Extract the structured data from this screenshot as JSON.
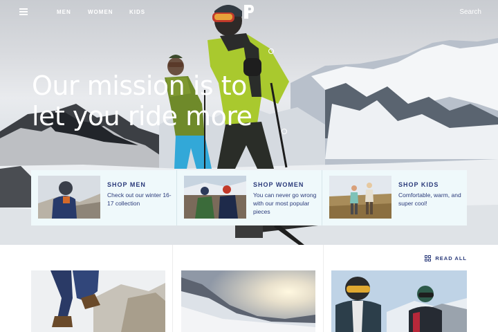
{
  "nav": {
    "links": [
      "MEN",
      "WOMEN",
      "KIDS"
    ],
    "search_label": "Search"
  },
  "hero": {
    "headline_line1": "Our mission is to",
    "headline_line2": "let you ride more"
  },
  "categories": [
    {
      "title": "SHOP MEN",
      "description": "Check out our winter 16-17 collection"
    },
    {
      "title": "SHOP WOMEN",
      "description": "You can never go wrong with our most popular pieces"
    },
    {
      "title": "SHOP KIDS",
      "description": "Comfortable, warm, and super cool!"
    }
  ],
  "blog": {
    "read_all_label": "READ ALL"
  },
  "colors": {
    "brand_navy": "#2a3a7a",
    "strip_bg": "#eff9fb",
    "jacket_lime": "#a9c92e"
  }
}
